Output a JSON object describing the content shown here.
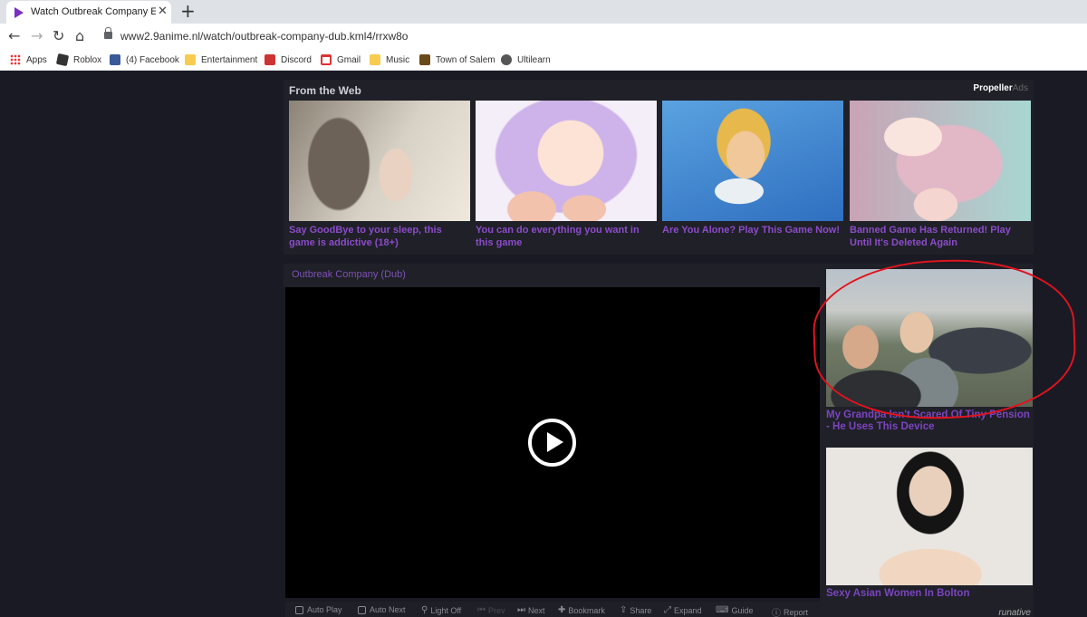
{
  "browser": {
    "tab_title": "Watch Outbreak Company English",
    "tab_close": "✕",
    "new_tab": "+",
    "url": "www2.9anime.nl/watch/outbreak-company-dub.kml4/rrxw8o",
    "bookmarks": [
      {
        "label": "Apps",
        "icon": "apps-grid-icon"
      },
      {
        "label": "Roblox",
        "icon": "roblox-icon"
      },
      {
        "label": "(4) Facebook",
        "icon": "facebook-icon"
      },
      {
        "label": "Entertainment",
        "icon": "folder-icon"
      },
      {
        "label": "Discord",
        "icon": "discord-icon"
      },
      {
        "label": "Gmail",
        "icon": "gmail-icon"
      },
      {
        "label": "Music",
        "icon": "folder-icon"
      },
      {
        "label": "Town of Salem",
        "icon": "town-of-salem-icon"
      },
      {
        "label": "Ultilearn",
        "icon": "globe-icon"
      }
    ]
  },
  "from_the_web": {
    "title": "From the Web",
    "brand_main": "Propeller",
    "brand_suffix": "Ads",
    "cards": [
      {
        "caption": "Say GoodBye to your sleep, this game is addictive (18+)"
      },
      {
        "caption": "You can do everything you want in this game"
      },
      {
        "caption": "Are You Alone? Play This Game Now!"
      },
      {
        "caption": "Banned Game Has Returned! Play Until It's Deleted Again"
      }
    ]
  },
  "player": {
    "title": "Outbreak Company (Dub)",
    "controls": {
      "auto_play": "Auto Play",
      "auto_next": "Auto Next",
      "light_off": "Light Off",
      "prev": "Prev",
      "next": "Next",
      "bookmark": "Bookmark",
      "share": "Share",
      "expand": "Expand",
      "guide": "Guide",
      "report": "Report"
    }
  },
  "sidebar_ads": {
    "ads": [
      {
        "caption": "My Grandpa Isn't Scared Of Tiny Pension - He Uses This Device"
      },
      {
        "caption": "Sexy Asian Women In Bolton"
      }
    ],
    "brand": "runative"
  },
  "colors": {
    "page_bg": "#1a1a24",
    "panel_bg": "#202028",
    "link_purple": "#8a4cc8",
    "annotation_red": "#e0141e"
  }
}
